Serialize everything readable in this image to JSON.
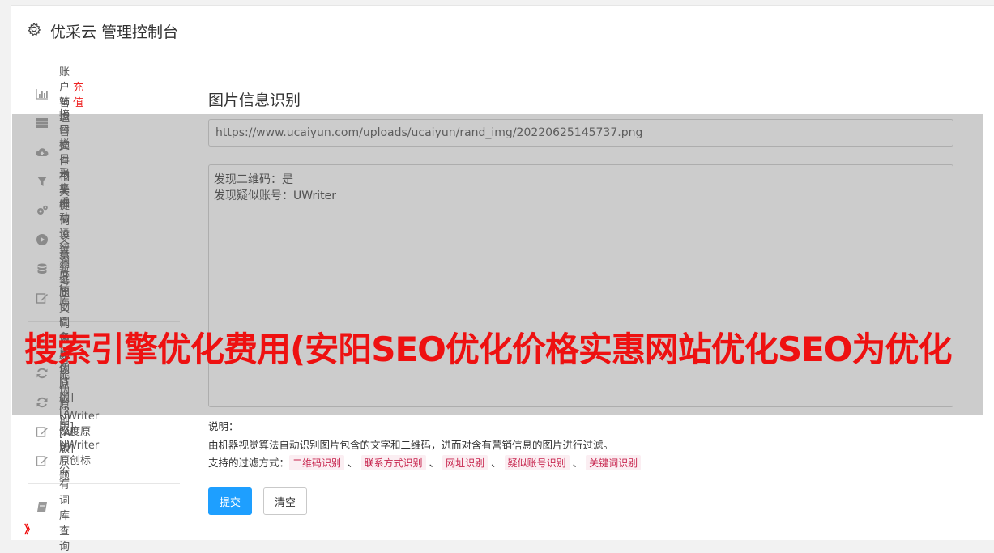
{
  "header": {
    "title": "优采云 管理控制台",
    "icon": "gear-icon"
  },
  "sidebar": {
    "items": [
      {
        "label": "账户管理",
        "extra": "充值",
        "icon": "bar-chart-icon"
      },
      {
        "label": "站点管理",
        "icon": "server-icon"
      },
      {
        "label": "接口文件相关",
        "icon": "cloud-upload-icon"
      },
      {
        "label": "栏目与关键词",
        "icon": "filter-icon"
      },
      {
        "label": "采集细节设置",
        "icon": "gears-icon"
      },
      {
        "label": "手动运行测试",
        "icon": "play-circle-icon"
      },
      {
        "label": "文章暂存库",
        "icon": "database-icon"
      },
      {
        "label": "深度原创任务",
        "icon": "edit-icon"
      },
      {
        "label": "同义词伪原创[1版]",
        "icon": "refresh-icon"
      },
      {
        "label": "同义词伪原创[2版]",
        "icon": "refresh-icon"
      },
      {
        "label": "智能伪原创[AI版]",
        "icon": "refresh-icon"
      },
      {
        "label": "UWriter深度原创",
        "icon": "edit-icon"
      },
      {
        "label": "UWriter原创标题",
        "icon": "edit-icon"
      },
      {
        "label": "公有词库查询",
        "icon": "book-icon"
      }
    ]
  },
  "main": {
    "title": "图片信息识别",
    "url_value": "https://www.ucaiyun.com/uploads/ucaiyun/rand_img/20220625145737.png",
    "result_lines": [
      "发现二维码：是",
      "发现疑似账号：UWriter"
    ],
    "desc_label": "说明：",
    "desc_text": "由机器视觉算法自动识别图片包含的文字和二维码，进而对含有营销信息的图片进行过滤。",
    "filter_label": "支持的过滤方式：",
    "filters": [
      "二维码识别",
      "联系方式识别",
      "网址识别",
      "疑似账号识别",
      "关键词识别"
    ],
    "filter_separator": "、",
    "submit_label": "提交",
    "clear_label": "清空"
  },
  "overlay": {
    "watermark_text": "搜索引擎优化费用(安阳SEO优化价格实惠网站优化SEO为优化",
    "watermark_color": "#ee1111",
    "corner_mark": "》"
  }
}
